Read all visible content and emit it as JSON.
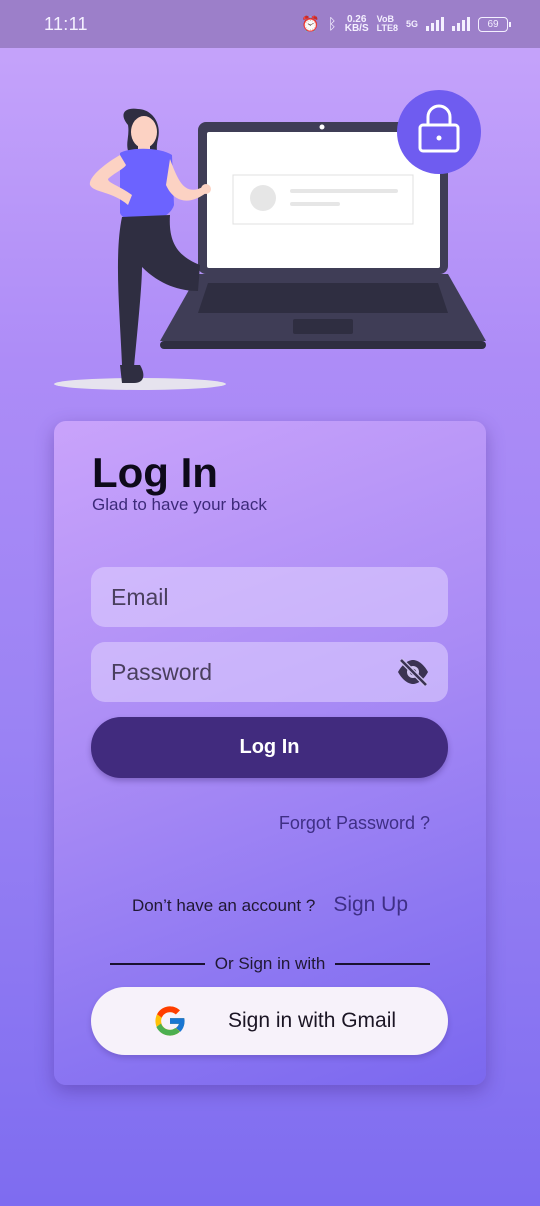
{
  "status_bar": {
    "time": "11:11",
    "speed_value": "0.26",
    "speed_unit": "KB/S",
    "volte_top": "VoB",
    "volte_bottom": "LTE8",
    "network": "5G",
    "battery": "69"
  },
  "illustration": {
    "icons": [
      "woman-figure",
      "laptop",
      "lock-icon"
    ]
  },
  "login_card": {
    "title": "Log In",
    "subtitle": "Glad to have your back",
    "email": {
      "placeholder": "Email",
      "value": ""
    },
    "password": {
      "placeholder": "Password",
      "value": "",
      "toggle_icon": "eye-off-icon"
    },
    "login_button": "Log In",
    "forgot_password": "Forgot Password ?",
    "signup_prompt": "Don’t have an account ?",
    "signup_link": "Sign Up",
    "divider_text": "Or Sign in with",
    "gmail_button": "Sign in with Gmail"
  },
  "colors": {
    "accent": "#412b7e",
    "link": "#3f2f86",
    "lock_badge": "#6f5cf0"
  }
}
